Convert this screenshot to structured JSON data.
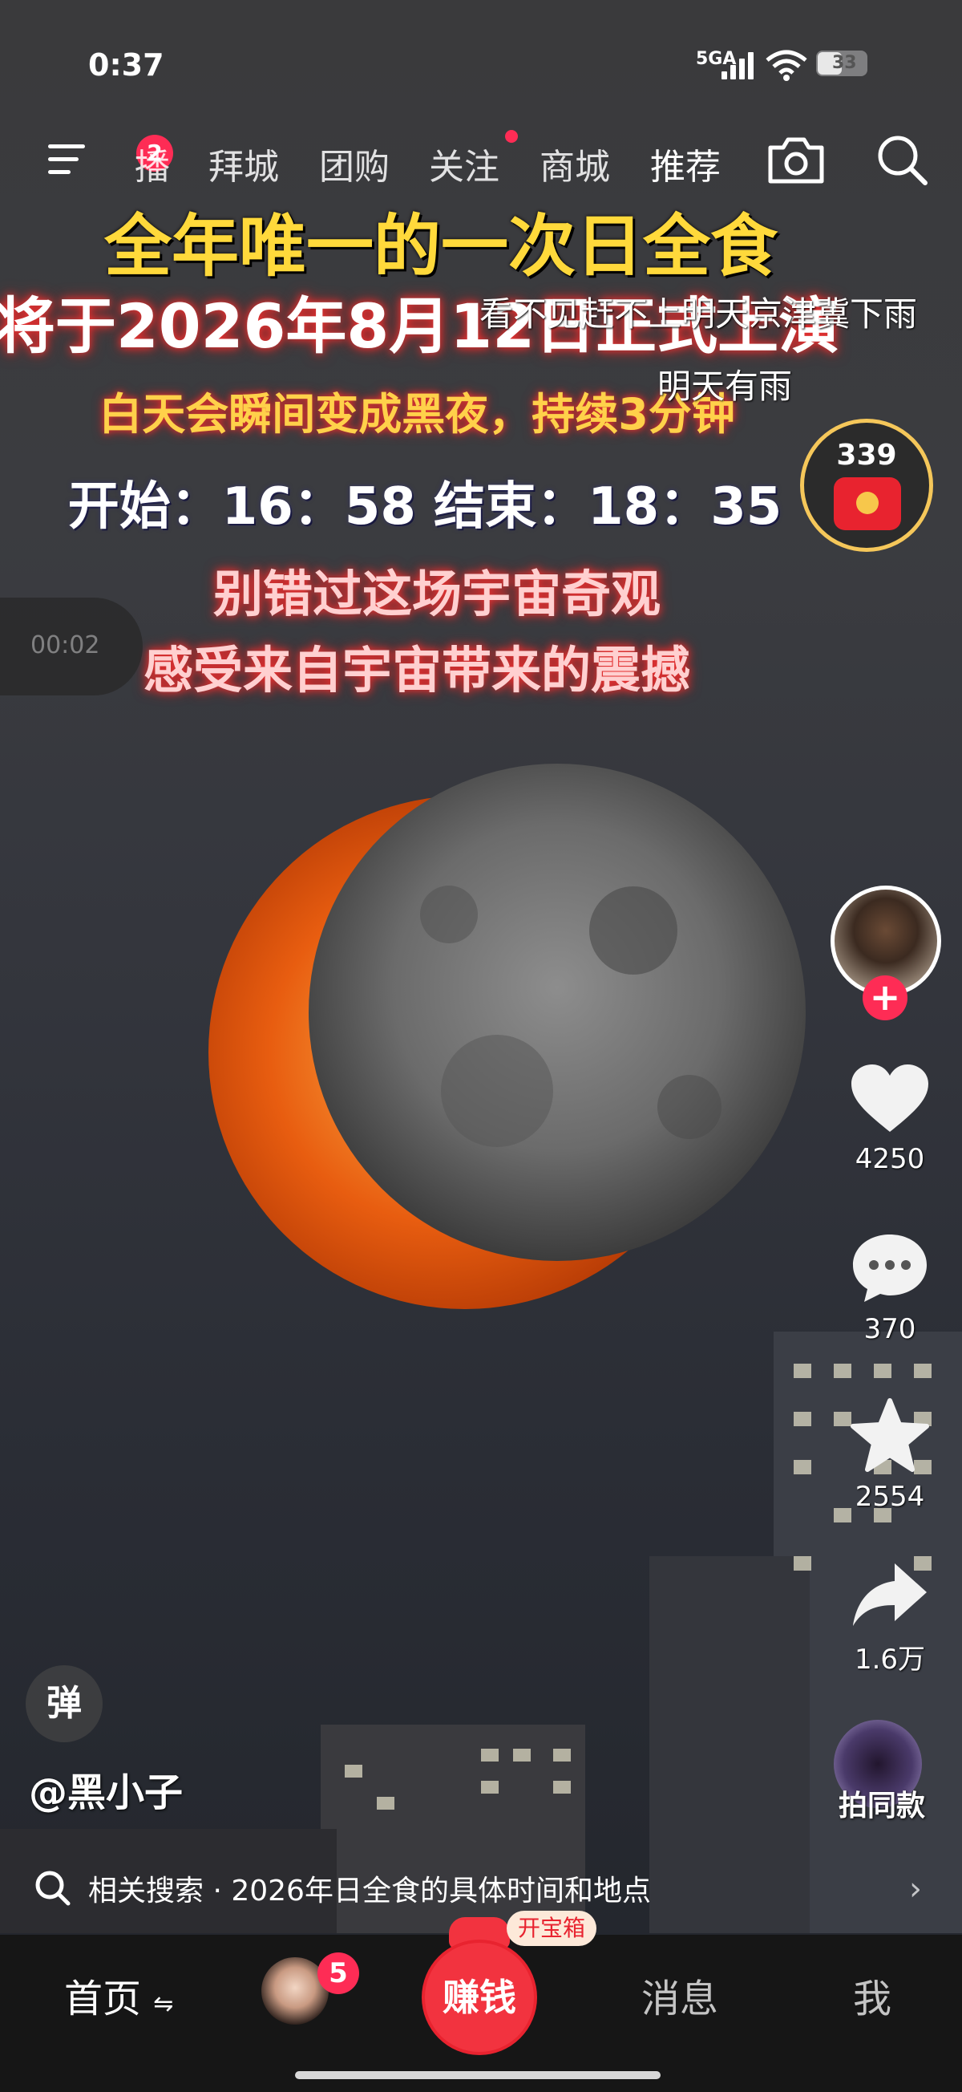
{
  "status_bar": {
    "time": "0:37",
    "network": "5GA",
    "battery": "33"
  },
  "top_nav": {
    "menu_badge": "2",
    "tabs": [
      "播",
      "拜城",
      "团购",
      "关注",
      "商城",
      "推荐"
    ],
    "active_tab": "推荐",
    "camera_icon": "camera-icon",
    "search_icon": "search-icon"
  },
  "video_overlay": {
    "line1": "全年唯一的一次日全食",
    "line2": "将于2026年8月12日正式上演",
    "line3": "白天会瞬间变成黑夜，持续3分钟",
    "line4": "开始：16：58 结束：18：35",
    "line5": "别错过这场宇宙奇观",
    "line6": "感受来自宇宙带来的震撼"
  },
  "danmaku": [
    "看不见赶不上明天京津冀下雨",
    "明天有雨"
  ],
  "progress_pill": "00:02",
  "red_packet": {
    "count": "339"
  },
  "actions": {
    "like_count": "4250",
    "comment_count": "370",
    "favorite_count": "2554",
    "share_count": "1.6万",
    "shoot_same": "拍同款"
  },
  "bottom_info": {
    "danmu_button": "弹",
    "author": "@黑小子",
    "related_search": "相关搜索 · 2026年日全食的具体时间和地点"
  },
  "bottom_nav": {
    "home": "首页",
    "friend_badge": "5",
    "earn": "赚钱",
    "treasure": "开宝箱",
    "messages": "消息",
    "me": "我"
  },
  "colors": {
    "accent": "#fe2c55",
    "earn_red": "#f2333f",
    "overlay_yellow": "#ffd93b"
  }
}
